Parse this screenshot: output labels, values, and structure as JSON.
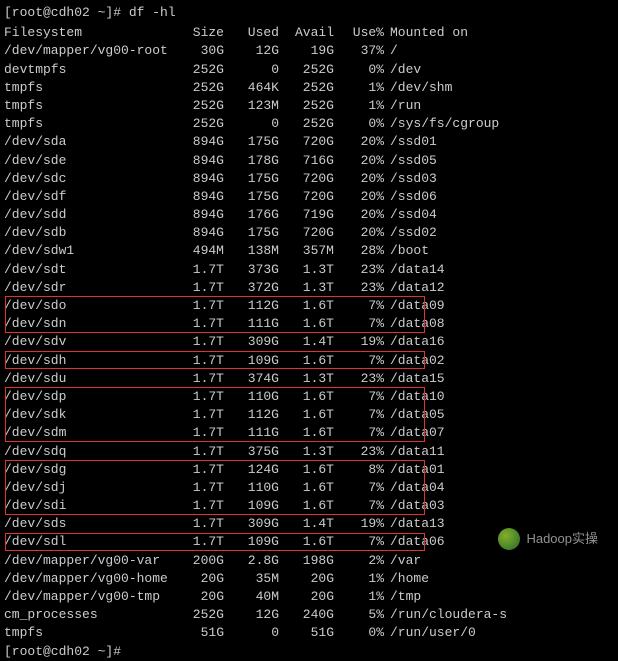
{
  "prompt": "[root@cdh02 ~]# df -hl",
  "header": {
    "fs": "Filesystem",
    "size": "Size",
    "used": "Used",
    "avail": "Avail",
    "usep": "Use%",
    "mount": "Mounted on"
  },
  "rows": [
    {
      "fs": "/dev/mapper/vg00-root",
      "size": "30G",
      "used": "12G",
      "avail": "19G",
      "usep": "37%",
      "mount": "/"
    },
    {
      "fs": "devtmpfs",
      "size": "252G",
      "used": "0",
      "avail": "252G",
      "usep": "0%",
      "mount": "/dev"
    },
    {
      "fs": "tmpfs",
      "size": "252G",
      "used": "464K",
      "avail": "252G",
      "usep": "1%",
      "mount": "/dev/shm"
    },
    {
      "fs": "tmpfs",
      "size": "252G",
      "used": "123M",
      "avail": "252G",
      "usep": "1%",
      "mount": "/run"
    },
    {
      "fs": "tmpfs",
      "size": "252G",
      "used": "0",
      "avail": "252G",
      "usep": "0%",
      "mount": "/sys/fs/cgroup"
    },
    {
      "fs": "/dev/sda",
      "size": "894G",
      "used": "175G",
      "avail": "720G",
      "usep": "20%",
      "mount": "/ssd01"
    },
    {
      "fs": "/dev/sde",
      "size": "894G",
      "used": "178G",
      "avail": "716G",
      "usep": "20%",
      "mount": "/ssd05"
    },
    {
      "fs": "/dev/sdc",
      "size": "894G",
      "used": "175G",
      "avail": "720G",
      "usep": "20%",
      "mount": "/ssd03"
    },
    {
      "fs": "/dev/sdf",
      "size": "894G",
      "used": "175G",
      "avail": "720G",
      "usep": "20%",
      "mount": "/ssd06"
    },
    {
      "fs": "/dev/sdd",
      "size": "894G",
      "used": "176G",
      "avail": "719G",
      "usep": "20%",
      "mount": "/ssd04"
    },
    {
      "fs": "/dev/sdb",
      "size": "894G",
      "used": "175G",
      "avail": "720G",
      "usep": "20%",
      "mount": "/ssd02"
    },
    {
      "fs": "/dev/sdw1",
      "size": "494M",
      "used": "138M",
      "avail": "357M",
      "usep": "28%",
      "mount": "/boot"
    },
    {
      "fs": "/dev/sdt",
      "size": "1.7T",
      "used": "373G",
      "avail": "1.3T",
      "usep": "23%",
      "mount": "/data14"
    },
    {
      "fs": "/dev/sdr",
      "size": "1.7T",
      "used": "372G",
      "avail": "1.3T",
      "usep": "23%",
      "mount": "/data12"
    },
    {
      "fs": "/dev/sdo",
      "size": "1.7T",
      "used": "112G",
      "avail": "1.6T",
      "usep": "7%",
      "mount": "/data09"
    },
    {
      "fs": "/dev/sdn",
      "size": "1.7T",
      "used": "111G",
      "avail": "1.6T",
      "usep": "7%",
      "mount": "/data08"
    },
    {
      "fs": "/dev/sdv",
      "size": "1.7T",
      "used": "309G",
      "avail": "1.4T",
      "usep": "19%",
      "mount": "/data16"
    },
    {
      "fs": "/dev/sdh",
      "size": "1.7T",
      "used": "109G",
      "avail": "1.6T",
      "usep": "7%",
      "mount": "/data02"
    },
    {
      "fs": "/dev/sdu",
      "size": "1.7T",
      "used": "374G",
      "avail": "1.3T",
      "usep": "23%",
      "mount": "/data15"
    },
    {
      "fs": "/dev/sdp",
      "size": "1.7T",
      "used": "110G",
      "avail": "1.6T",
      "usep": "7%",
      "mount": "/data10"
    },
    {
      "fs": "/dev/sdk",
      "size": "1.7T",
      "used": "112G",
      "avail": "1.6T",
      "usep": "7%",
      "mount": "/data05"
    },
    {
      "fs": "/dev/sdm",
      "size": "1.7T",
      "used": "111G",
      "avail": "1.6T",
      "usep": "7%",
      "mount": "/data07"
    },
    {
      "fs": "/dev/sdq",
      "size": "1.7T",
      "used": "375G",
      "avail": "1.3T",
      "usep": "23%",
      "mount": "/data11"
    },
    {
      "fs": "/dev/sdg",
      "size": "1.7T",
      "used": "124G",
      "avail": "1.6T",
      "usep": "8%",
      "mount": "/data01"
    },
    {
      "fs": "/dev/sdj",
      "size": "1.7T",
      "used": "110G",
      "avail": "1.6T",
      "usep": "7%",
      "mount": "/data04"
    },
    {
      "fs": "/dev/sdi",
      "size": "1.7T",
      "used": "109G",
      "avail": "1.6T",
      "usep": "7%",
      "mount": "/data03"
    },
    {
      "fs": "/dev/sds",
      "size": "1.7T",
      "used": "309G",
      "avail": "1.4T",
      "usep": "19%",
      "mount": "/data13"
    },
    {
      "fs": "/dev/sdl",
      "size": "1.7T",
      "used": "109G",
      "avail": "1.6T",
      "usep": "7%",
      "mount": "/data06"
    },
    {
      "fs": "/dev/mapper/vg00-var",
      "size": "200G",
      "used": "2.8G",
      "avail": "198G",
      "usep": "2%",
      "mount": "/var"
    },
    {
      "fs": "/dev/mapper/vg00-home",
      "size": "20G",
      "used": "35M",
      "avail": "20G",
      "usep": "1%",
      "mount": "/home"
    },
    {
      "fs": "/dev/mapper/vg00-tmp",
      "size": "20G",
      "used": "40M",
      "avail": "20G",
      "usep": "1%",
      "mount": "/tmp"
    },
    {
      "fs": "cm_processes",
      "size": "252G",
      "used": "12G",
      "avail": "240G",
      "usep": "5%",
      "mount": "/run/cloudera-s"
    },
    {
      "fs": "tmpfs",
      "size": "51G",
      "used": "0",
      "avail": "51G",
      "usep": "0%",
      "mount": "/run/user/0"
    }
  ],
  "highlights": [
    {
      "start": 14,
      "end": 15
    },
    {
      "start": 17,
      "end": 17
    },
    {
      "start": 19,
      "end": 21
    },
    {
      "start": 23,
      "end": 25
    },
    {
      "start": 27,
      "end": 27
    }
  ],
  "prompt2": "[root@cdh02 ~]# ",
  "watermark": "Hadoop实操"
}
